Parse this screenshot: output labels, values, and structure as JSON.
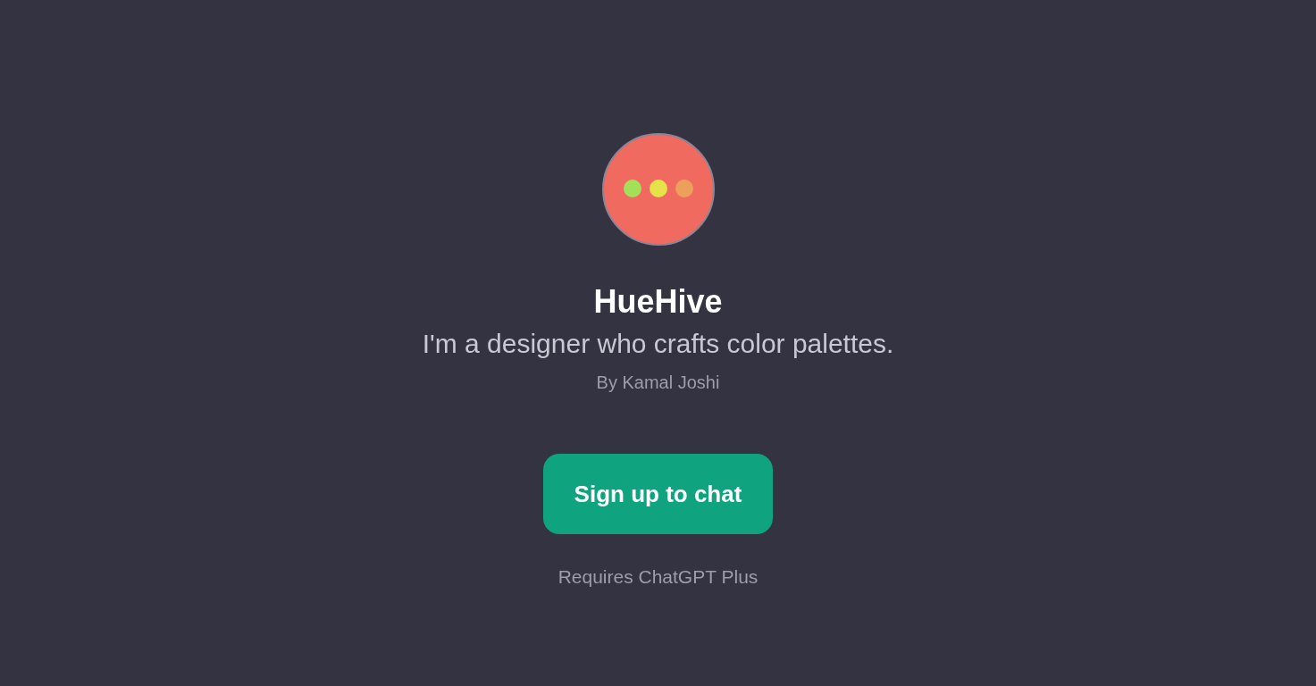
{
  "gpt": {
    "name": "HueHive",
    "description": "I'm a designer who crafts color palettes.",
    "author": "By Kamal Joshi"
  },
  "action": {
    "label": "Sign up to chat"
  },
  "note": "Requires ChatGPT Plus"
}
